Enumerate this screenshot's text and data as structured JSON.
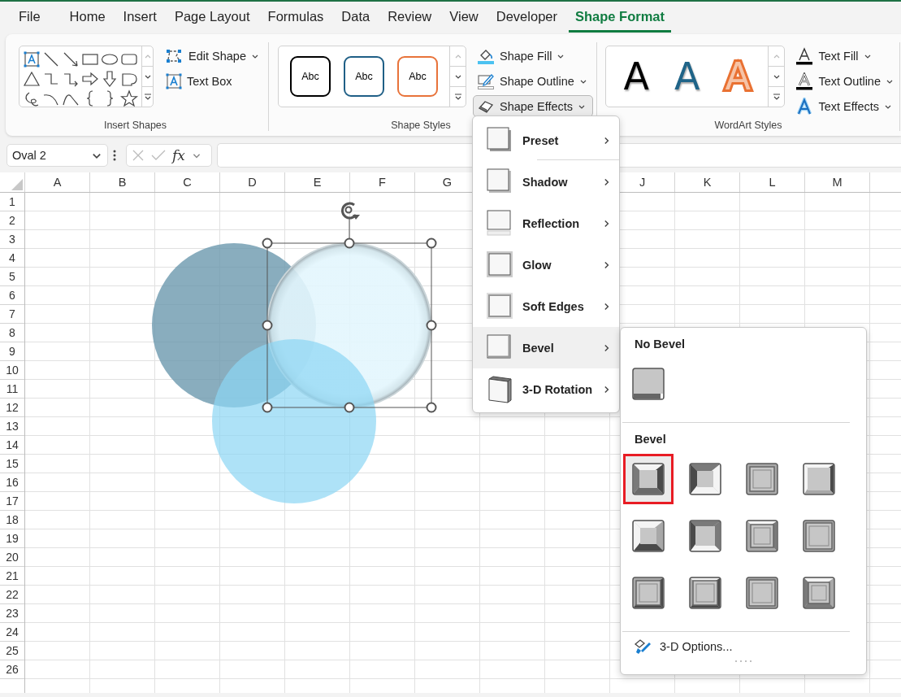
{
  "ribbon_tabs": [
    {
      "label": "File",
      "selected": false
    },
    {
      "label": "Home",
      "selected": false
    },
    {
      "label": "Insert",
      "selected": false
    },
    {
      "label": "Page Layout",
      "selected": false
    },
    {
      "label": "Formulas",
      "selected": false
    },
    {
      "label": "Data",
      "selected": false
    },
    {
      "label": "Review",
      "selected": false
    },
    {
      "label": "View",
      "selected": false
    },
    {
      "label": "Developer",
      "selected": false
    },
    {
      "label": "Shape Format",
      "selected": true
    }
  ],
  "insert_shapes": {
    "buttons": [
      {
        "label": "Edit Shape",
        "dropdown": true
      },
      {
        "label": "Text Box",
        "dropdown": false
      }
    ],
    "group_label": "Insert Shapes"
  },
  "shape_styles": {
    "thumbnails": [
      {
        "label": "Abc",
        "color": "#000000"
      },
      {
        "label": "Abc",
        "color": "#1f5f86"
      },
      {
        "label": "Abc",
        "color": "#e8733a"
      }
    ],
    "buttons": [
      {
        "label": "Shape Fill",
        "pressed": false
      },
      {
        "label": "Shape Outline",
        "pressed": false
      },
      {
        "label": "Shape Effects",
        "pressed": true
      }
    ],
    "group_label": "Shape Styles"
  },
  "wordart_styles": {
    "thumbnails": [
      {
        "label": "A",
        "color": "#000000",
        "outlined": false
      },
      {
        "label": "A",
        "color": "#1f6488",
        "outlined": false
      },
      {
        "label": "A",
        "color": "#f6c3a6",
        "outlined": true
      }
    ],
    "buttons": [
      {
        "label": "Text Fill"
      },
      {
        "label": "Text Outline"
      },
      {
        "label": "Text Effects"
      }
    ],
    "group_label": "WordArt Styles"
  },
  "formula_bar": {
    "name_box": "Oval 2",
    "function_label": "fx"
  },
  "columns_left": [
    "A",
    "B",
    "C",
    "D",
    "E",
    "F",
    "G"
  ],
  "columns_right": [
    "J",
    "K",
    "L",
    "M"
  ],
  "rows": [
    "1",
    "2",
    "3",
    "4",
    "5",
    "6",
    "7",
    "8",
    "9",
    "10",
    "11",
    "12",
    "13",
    "14",
    "15",
    "16",
    "17",
    "18",
    "19",
    "20",
    "21",
    "22",
    "23",
    "24",
    "25",
    "26"
  ],
  "shapes": [
    {
      "selected": false
    },
    {
      "selected": true
    },
    {
      "selected": false
    }
  ],
  "shape_effects_menu": {
    "items": [
      {
        "label": "Preset",
        "expanded": false
      },
      {
        "label": "Shadow",
        "expanded": false
      },
      {
        "label": "Reflection",
        "expanded": false
      },
      {
        "label": "Glow",
        "expanded": false
      },
      {
        "label": "Soft Edges",
        "expanded": false
      },
      {
        "label": "Bevel",
        "expanded": true
      },
      {
        "label": "3-D Rotation",
        "expanded": false
      }
    ]
  },
  "bevel_submenu": {
    "sections": [
      {
        "heading": "No Bevel",
        "presets": [
          {
            "selected": false,
            "annotated": false
          }
        ]
      },
      {
        "heading": "Bevel",
        "presets": [
          {
            "selected": true,
            "annotated": true
          },
          {
            "selected": false,
            "annotated": false
          },
          {
            "selected": false,
            "annotated": false
          },
          {
            "selected": false,
            "annotated": false
          },
          {
            "selected": false,
            "annotated": false
          },
          {
            "selected": false,
            "annotated": false
          },
          {
            "selected": false,
            "annotated": false
          },
          {
            "selected": false,
            "annotated": false
          },
          {
            "selected": false,
            "annotated": false
          },
          {
            "selected": false,
            "annotated": false
          },
          {
            "selected": false,
            "annotated": false
          },
          {
            "selected": false,
            "annotated": false
          }
        ]
      }
    ],
    "footer": "3-D Options..."
  }
}
